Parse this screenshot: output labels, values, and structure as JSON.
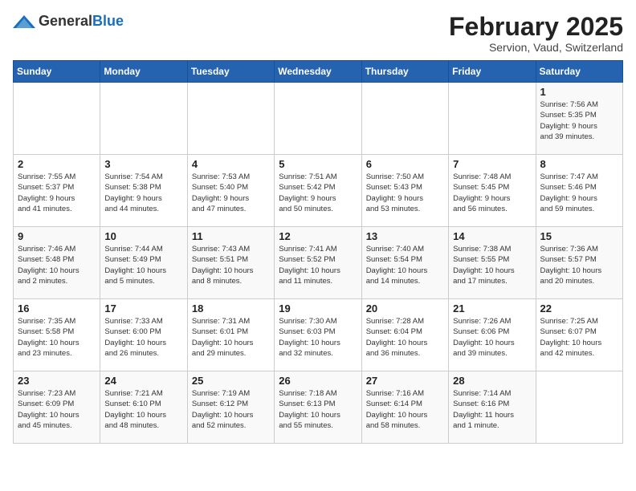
{
  "logo": {
    "general": "General",
    "blue": "Blue"
  },
  "header": {
    "month": "February 2025",
    "location": "Servion, Vaud, Switzerland"
  },
  "weekdays": [
    "Sunday",
    "Monday",
    "Tuesday",
    "Wednesday",
    "Thursday",
    "Friday",
    "Saturday"
  ],
  "weeks": [
    [
      {
        "day": "",
        "info": ""
      },
      {
        "day": "",
        "info": ""
      },
      {
        "day": "",
        "info": ""
      },
      {
        "day": "",
        "info": ""
      },
      {
        "day": "",
        "info": ""
      },
      {
        "day": "",
        "info": ""
      },
      {
        "day": "1",
        "info": "Sunrise: 7:56 AM\nSunset: 5:35 PM\nDaylight: 9 hours\nand 39 minutes."
      }
    ],
    [
      {
        "day": "2",
        "info": "Sunrise: 7:55 AM\nSunset: 5:37 PM\nDaylight: 9 hours\nand 41 minutes."
      },
      {
        "day": "3",
        "info": "Sunrise: 7:54 AM\nSunset: 5:38 PM\nDaylight: 9 hours\nand 44 minutes."
      },
      {
        "day": "4",
        "info": "Sunrise: 7:53 AM\nSunset: 5:40 PM\nDaylight: 9 hours\nand 47 minutes."
      },
      {
        "day": "5",
        "info": "Sunrise: 7:51 AM\nSunset: 5:42 PM\nDaylight: 9 hours\nand 50 minutes."
      },
      {
        "day": "6",
        "info": "Sunrise: 7:50 AM\nSunset: 5:43 PM\nDaylight: 9 hours\nand 53 minutes."
      },
      {
        "day": "7",
        "info": "Sunrise: 7:48 AM\nSunset: 5:45 PM\nDaylight: 9 hours\nand 56 minutes."
      },
      {
        "day": "8",
        "info": "Sunrise: 7:47 AM\nSunset: 5:46 PM\nDaylight: 9 hours\nand 59 minutes."
      }
    ],
    [
      {
        "day": "9",
        "info": "Sunrise: 7:46 AM\nSunset: 5:48 PM\nDaylight: 10 hours\nand 2 minutes."
      },
      {
        "day": "10",
        "info": "Sunrise: 7:44 AM\nSunset: 5:49 PM\nDaylight: 10 hours\nand 5 minutes."
      },
      {
        "day": "11",
        "info": "Sunrise: 7:43 AM\nSunset: 5:51 PM\nDaylight: 10 hours\nand 8 minutes."
      },
      {
        "day": "12",
        "info": "Sunrise: 7:41 AM\nSunset: 5:52 PM\nDaylight: 10 hours\nand 11 minutes."
      },
      {
        "day": "13",
        "info": "Sunrise: 7:40 AM\nSunset: 5:54 PM\nDaylight: 10 hours\nand 14 minutes."
      },
      {
        "day": "14",
        "info": "Sunrise: 7:38 AM\nSunset: 5:55 PM\nDaylight: 10 hours\nand 17 minutes."
      },
      {
        "day": "15",
        "info": "Sunrise: 7:36 AM\nSunset: 5:57 PM\nDaylight: 10 hours\nand 20 minutes."
      }
    ],
    [
      {
        "day": "16",
        "info": "Sunrise: 7:35 AM\nSunset: 5:58 PM\nDaylight: 10 hours\nand 23 minutes."
      },
      {
        "day": "17",
        "info": "Sunrise: 7:33 AM\nSunset: 6:00 PM\nDaylight: 10 hours\nand 26 minutes."
      },
      {
        "day": "18",
        "info": "Sunrise: 7:31 AM\nSunset: 6:01 PM\nDaylight: 10 hours\nand 29 minutes."
      },
      {
        "day": "19",
        "info": "Sunrise: 7:30 AM\nSunset: 6:03 PM\nDaylight: 10 hours\nand 32 minutes."
      },
      {
        "day": "20",
        "info": "Sunrise: 7:28 AM\nSunset: 6:04 PM\nDaylight: 10 hours\nand 36 minutes."
      },
      {
        "day": "21",
        "info": "Sunrise: 7:26 AM\nSunset: 6:06 PM\nDaylight: 10 hours\nand 39 minutes."
      },
      {
        "day": "22",
        "info": "Sunrise: 7:25 AM\nSunset: 6:07 PM\nDaylight: 10 hours\nand 42 minutes."
      }
    ],
    [
      {
        "day": "23",
        "info": "Sunrise: 7:23 AM\nSunset: 6:09 PM\nDaylight: 10 hours\nand 45 minutes."
      },
      {
        "day": "24",
        "info": "Sunrise: 7:21 AM\nSunset: 6:10 PM\nDaylight: 10 hours\nand 48 minutes."
      },
      {
        "day": "25",
        "info": "Sunrise: 7:19 AM\nSunset: 6:12 PM\nDaylight: 10 hours\nand 52 minutes."
      },
      {
        "day": "26",
        "info": "Sunrise: 7:18 AM\nSunset: 6:13 PM\nDaylight: 10 hours\nand 55 minutes."
      },
      {
        "day": "27",
        "info": "Sunrise: 7:16 AM\nSunset: 6:14 PM\nDaylight: 10 hours\nand 58 minutes."
      },
      {
        "day": "28",
        "info": "Sunrise: 7:14 AM\nSunset: 6:16 PM\nDaylight: 11 hours\nand 1 minute."
      },
      {
        "day": "",
        "info": ""
      }
    ]
  ]
}
